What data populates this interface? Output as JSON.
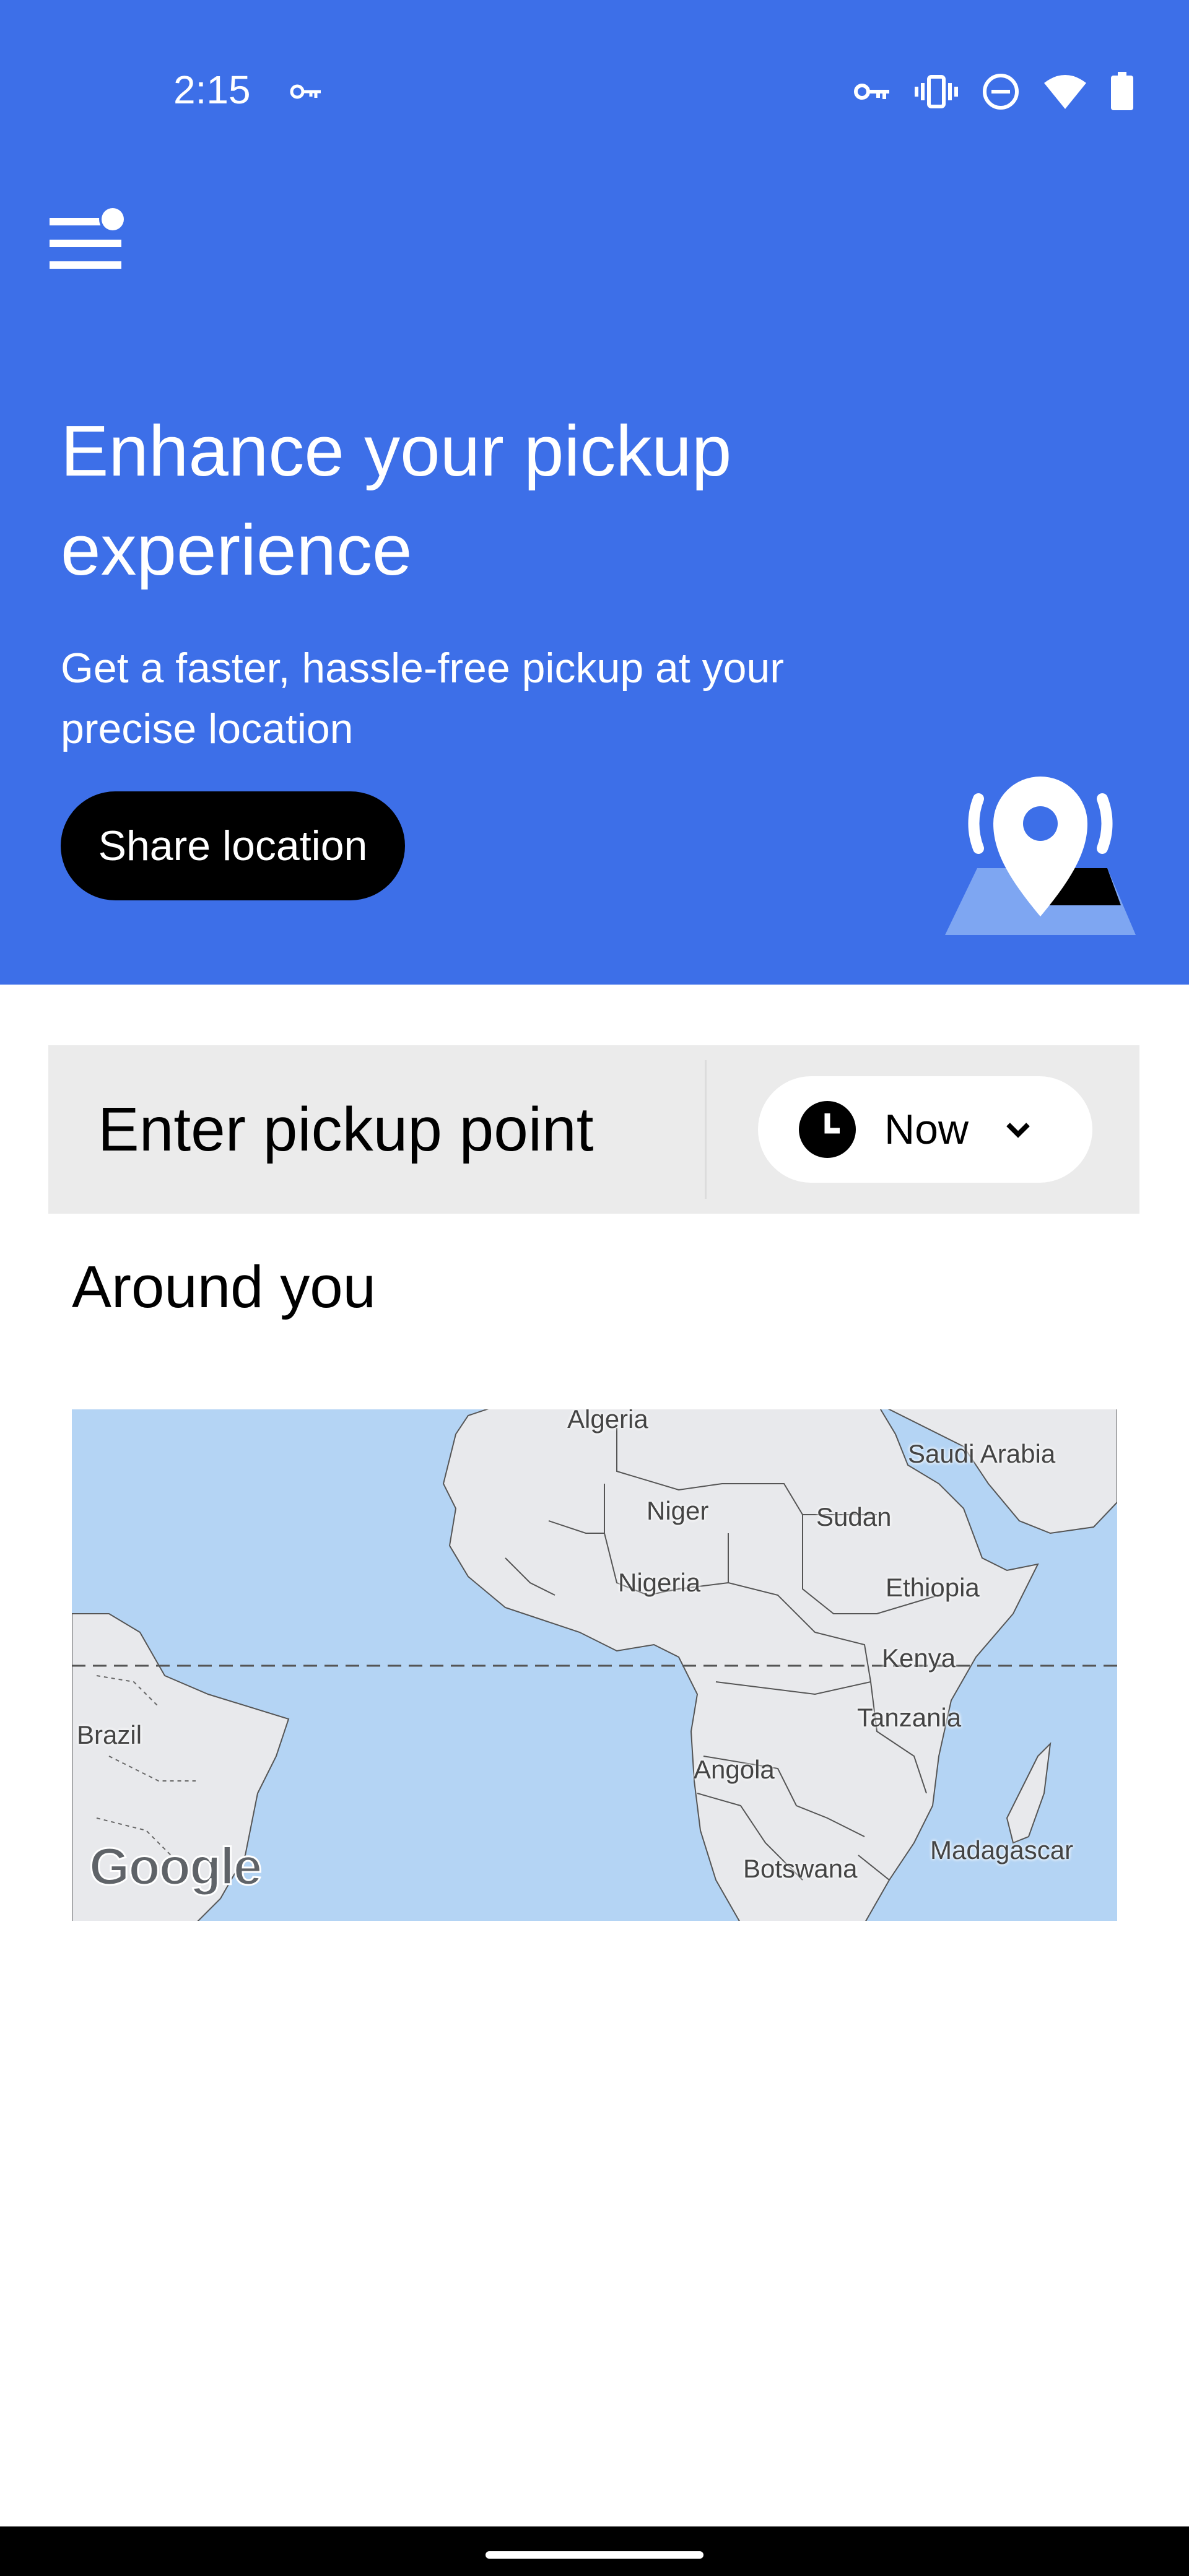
{
  "status_bar": {
    "time": "2:15"
  },
  "hero": {
    "title": "Enhance your pickup experience",
    "subtitle": "Get a faster, hassle-free pickup at your precise location",
    "share_button": "Share location",
    "background_color": "#3d6fe8"
  },
  "pickup": {
    "label": "Enter pickup point",
    "time_option": "Now"
  },
  "around": {
    "title": "Around you",
    "map_labels": {
      "algeria": "Algeria",
      "saudi_arabia": "Saudi Arabia",
      "niger": "Niger",
      "sudan": "Sudan",
      "nigeria": "Nigeria",
      "ethiopia": "Ethiopia",
      "kenya": "Kenya",
      "brazil": "Brazil",
      "tanzania": "Tanzania",
      "angola": "Angola",
      "botswana": "Botswana",
      "madagascar": "Madagascar"
    },
    "map_attribution": "Google"
  }
}
